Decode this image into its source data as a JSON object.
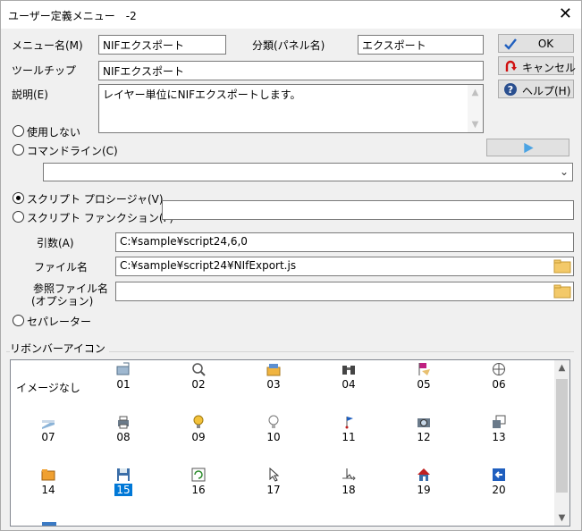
{
  "window": {
    "title": "ユーザー定義メニュー　-2",
    "close": "✕"
  },
  "menu_name": {
    "label": "メニュー名(M)",
    "value": "NIFエクスポート"
  },
  "category": {
    "label": "分類(パネル名)",
    "value": "エクスポート"
  },
  "tooltip": {
    "label": "ツールチップ",
    "value": "NIFエクスポート"
  },
  "description": {
    "label": "説明(E)",
    "value": "レイヤー単位にNIFエクスポートします。"
  },
  "buttons": {
    "ok": "OK",
    "cancel": "キャンセル",
    "help": "ヘルプ(H)"
  },
  "radios": {
    "unused": "使用しない",
    "command_line": "コマンドライン(C)",
    "script_procedure": "スクリプト プロシージャ(V)",
    "script_function": "スクリプト ファンクション(F)",
    "separator": "セパレーター",
    "selected": "script_procedure"
  },
  "args": {
    "label": "引数(A)",
    "value": "C:¥sample¥script24,6,0"
  },
  "file": {
    "label": "ファイル名",
    "value": "C:¥sample¥script24¥NIfExport.js"
  },
  "ref_file": {
    "label_line1": "参照ファイル名",
    "label_line2": "(オプション)",
    "value": ""
  },
  "ribbon": {
    "label": "リボンバーアイコン",
    "no_image": "イメージなし",
    "selected": "15",
    "icons": [
      {
        "num": "01",
        "icon": "open-folder-icon"
      },
      {
        "num": "02",
        "icon": "magnifier-icon"
      },
      {
        "num": "03",
        "icon": "folder-stack-icon"
      },
      {
        "num": "04",
        "icon": "binoculars-icon"
      },
      {
        "num": "05",
        "icon": "flag-hand-icon"
      },
      {
        "num": "06",
        "icon": "globe-icon"
      },
      {
        "num": "07",
        "icon": "panel-icon"
      },
      {
        "num": "08",
        "icon": "printer-icon"
      },
      {
        "num": "09",
        "icon": "bulb-on-icon"
      },
      {
        "num": "10",
        "icon": "bulb-off-icon"
      },
      {
        "num": "11",
        "icon": "pin-flag-icon"
      },
      {
        "num": "12",
        "icon": "camera-icon"
      },
      {
        "num": "13",
        "icon": "windows-icon"
      },
      {
        "num": "14",
        "icon": "folder-icon"
      },
      {
        "num": "15",
        "icon": "floppy-disk-icon"
      },
      {
        "num": "16",
        "icon": "refresh-icon"
      },
      {
        "num": "17",
        "icon": "cursor-icon"
      },
      {
        "num": "18",
        "icon": "move-cursor-icon"
      },
      {
        "num": "19",
        "icon": "house-icon"
      },
      {
        "num": "20",
        "icon": "import-icon"
      }
    ]
  }
}
